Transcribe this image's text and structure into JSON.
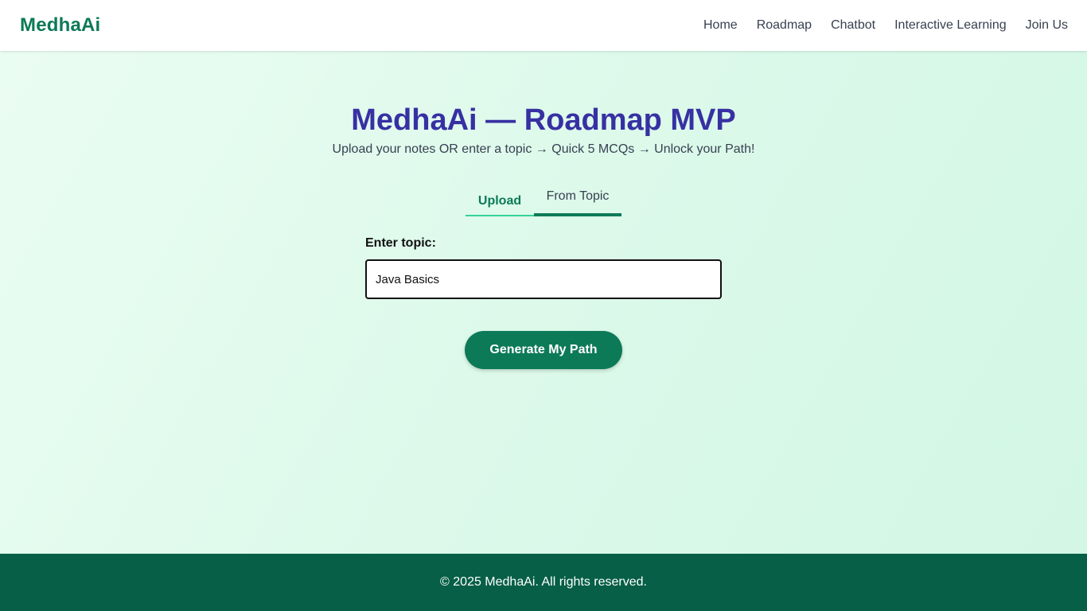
{
  "header": {
    "brand": "MedhaAi",
    "nav": [
      {
        "label": "Home"
      },
      {
        "label": "Roadmap"
      },
      {
        "label": "Chatbot"
      },
      {
        "label": "Interactive Learning"
      },
      {
        "label": "Join Us"
      }
    ]
  },
  "hero": {
    "title": "MedhaAi — Roadmap MVP",
    "subtitle": "Upload your notes OR enter a topic → Quick 5 MCQs → Unlock your Path!"
  },
  "tabs": [
    {
      "label": "Upload"
    },
    {
      "label": "From Topic",
      "active": true
    }
  ],
  "form": {
    "label": "Enter topic:",
    "value": "Java Basics",
    "submit_label": "Generate My Path"
  },
  "footer": {
    "copyright": "© 2025 MedhaAi. All rights reserved."
  },
  "colors": {
    "brand_green": "#0d7a57",
    "title_indigo": "#3730a3",
    "footer_green": "#065f46",
    "tab_underline": "#34d399"
  }
}
